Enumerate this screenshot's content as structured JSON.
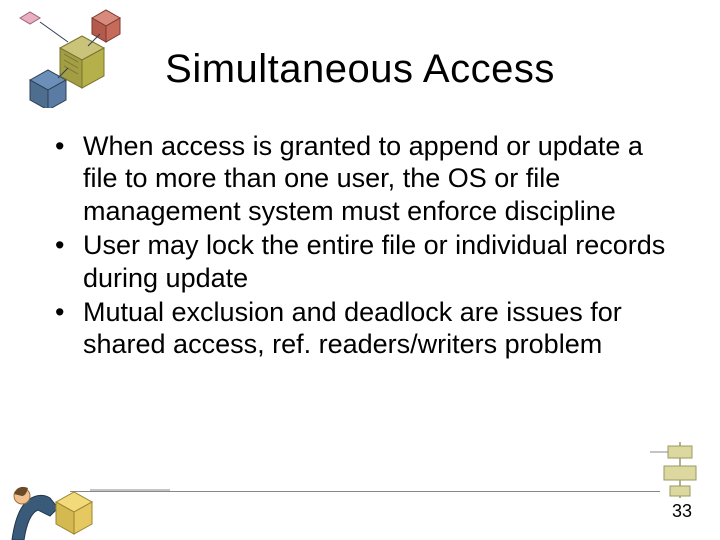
{
  "title": "Simultaneous Access",
  "bullets": [
    "When access is granted to append or update a file to more than one user, the OS or file management system must enforce discipline",
    "User may lock the entire file or individual records during update",
    "Mutual exclusion and deadlock are issues for shared access, ref. readers/writers problem"
  ],
  "page_number": "33",
  "colors": {
    "box_blue": "#6b8fb8",
    "box_olive": "#b6b04a",
    "box_red": "#c66a5a",
    "box_yellow": "#e6c860",
    "line": "#888888"
  }
}
